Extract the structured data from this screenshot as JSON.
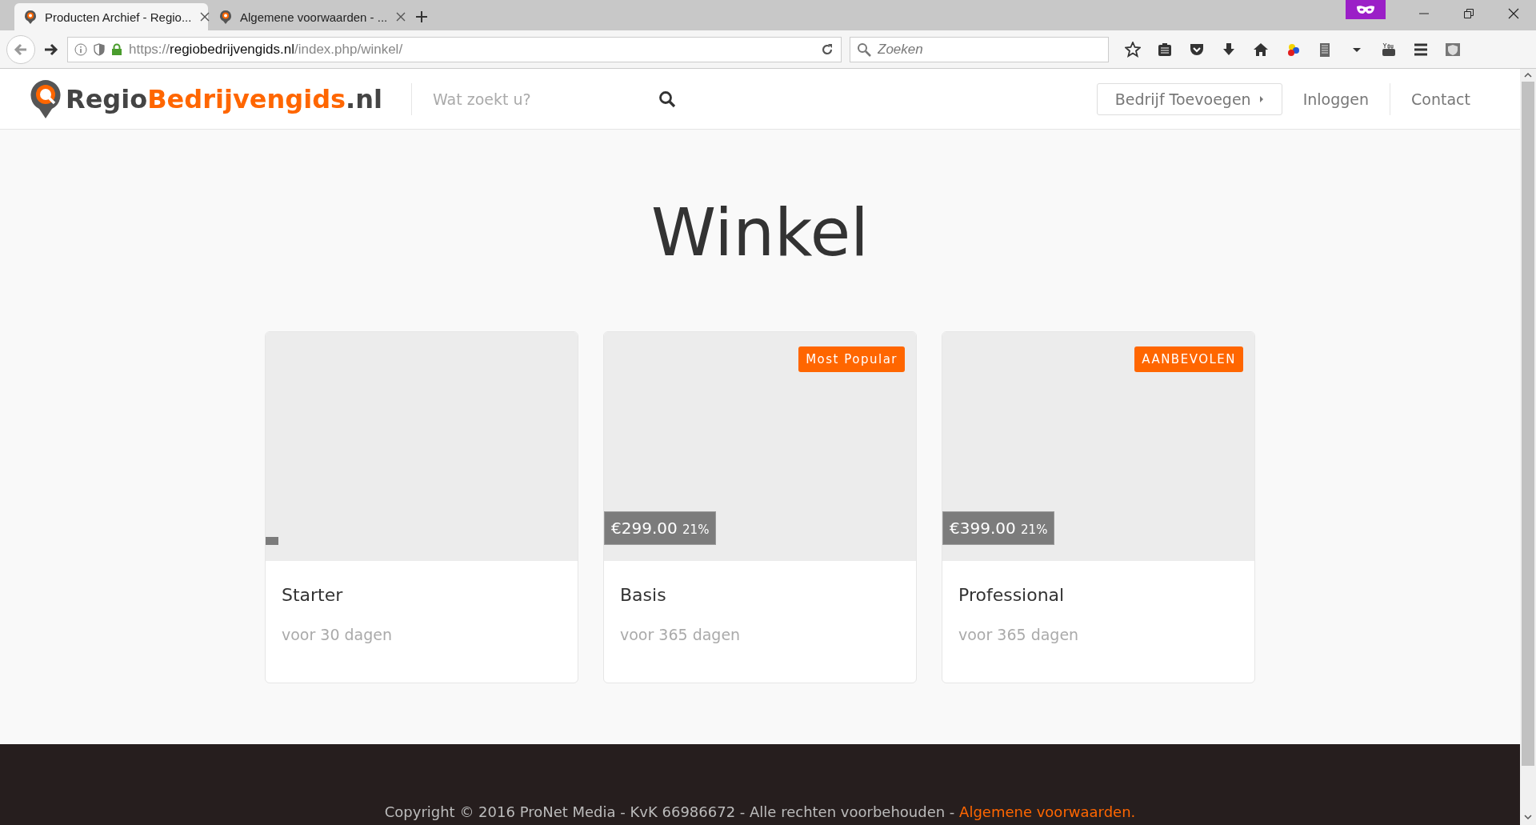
{
  "browser": {
    "tabs": [
      {
        "label": "Producten Archief - Regio...",
        "selected": true
      },
      {
        "label": "Algemene voorwaarden - ...",
        "selected": false
      }
    ],
    "url": {
      "scheme": "https://",
      "host": "regiobedrijvengids.nl",
      "path": "/index.php/winkel/"
    },
    "search": {
      "placeholder": "Zoeken"
    }
  },
  "site": {
    "logo": {
      "part_1": "Regio",
      "part_2": "Bedrijvengids",
      "part_3": ".nl"
    },
    "search": {
      "placeholder": "Wat zoekt u?"
    },
    "nav": [
      {
        "kind": "button",
        "label": "Bedrijf Toevoegen"
      },
      {
        "kind": "link",
        "label": "Inloggen"
      },
      {
        "kind": "link",
        "label": "Contact"
      }
    ]
  },
  "page": {
    "title": "Winkel",
    "products": [
      {
        "name": "Starter",
        "duration": "voor 30 dagen"
      },
      {
        "name": "Basis",
        "duration": "voor 365 dagen",
        "price": "€299.00",
        "vat": "21%",
        "badge": "Most Popular"
      },
      {
        "name": "Professional",
        "duration": "voor 365 dagen",
        "price": "€399.00",
        "vat": "21%",
        "badge": "AANBEVOLEN"
      }
    ]
  },
  "footer": {
    "text": "Copyright © 2016 ProNet Media - KvK 66986672 - Alle rechten voorbehouden - ",
    "link": "Algemene voorwaarden."
  }
}
